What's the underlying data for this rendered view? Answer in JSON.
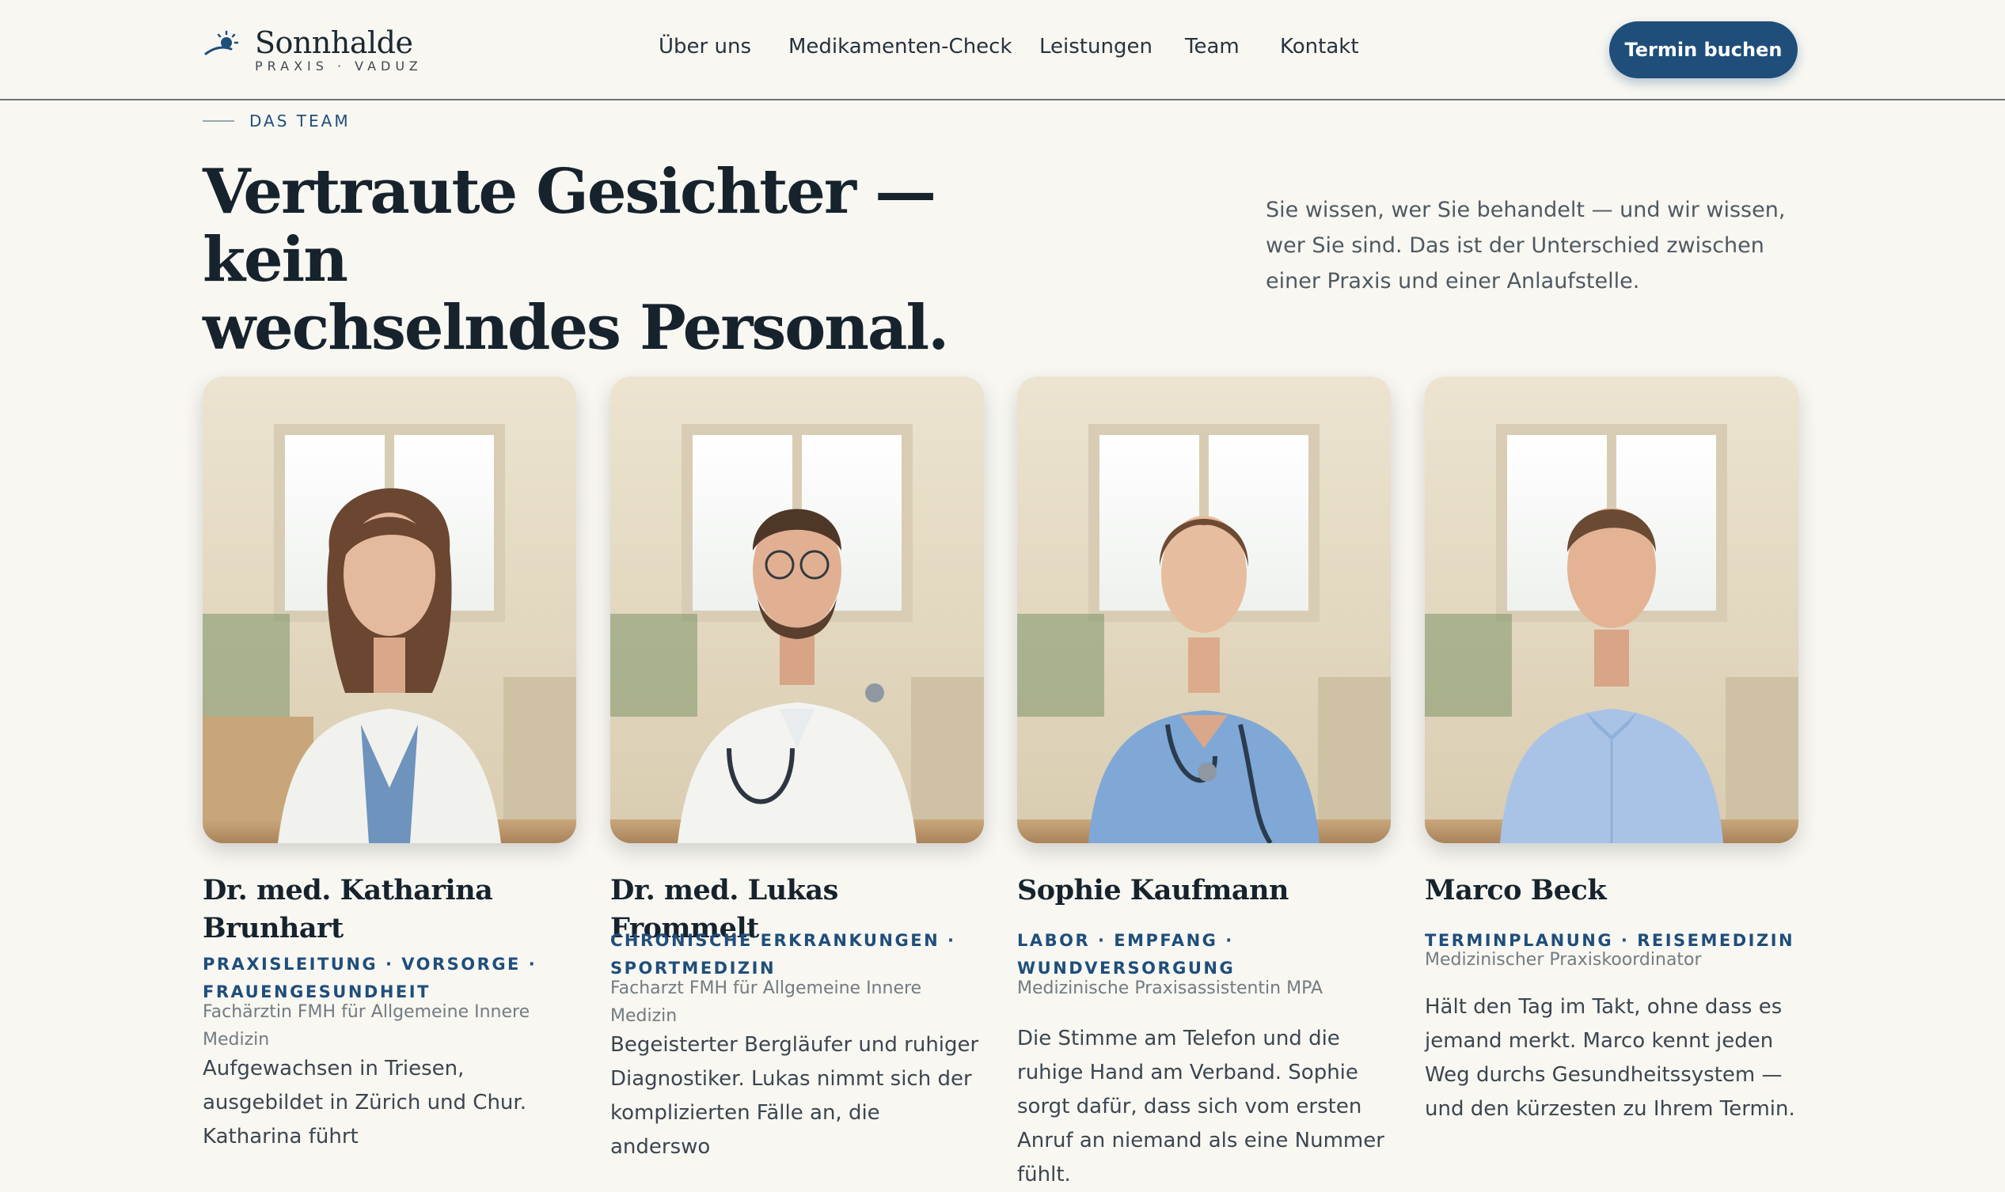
{
  "header": {
    "logo_name": "Sonnhalde",
    "logo_sub": "PRAXIS · VADUZ",
    "nav": [
      {
        "label": "Über uns"
      },
      {
        "label": "Medikamenten-Check"
      },
      {
        "label": "Leistungen"
      },
      {
        "label": "Team"
      },
      {
        "label": "Kontakt"
      }
    ],
    "cta_label": "Termin buchen"
  },
  "section": {
    "eyebrow": "DAS TEAM",
    "headline_line1": "Vertraute Gesichter — kein",
    "headline_line2": "wechselndes Personal.",
    "intro": "Sie wissen, wer Sie behandelt — und wir wissen, wer Sie sind. Das ist der Unterschied zwischen einer Praxis und einer Anlaufstelle."
  },
  "team": [
    {
      "name": "Dr. med. Katharina Brunhart",
      "tags": "PRAXISLEITUNG · VORSORGE · FRAUENGESUNDHEIT",
      "role": "Fachärztin FMH für Allgemeine Innere Medizin",
      "bio": "Aufgewachsen in Triesen, ausgebildet in Zürich und Chur. Katharina führt"
    },
    {
      "name": "Dr. med. Lukas Frommelt",
      "tags": "CHRONISCHE ERKRANKUNGEN · SPORTMEDIZIN",
      "role": "Facharzt FMH für Allgemeine Innere Medizin",
      "bio": "Begeisterter Bergläufer und ruhiger Diagnostiker. Lukas nimmt sich der komplizierten Fälle an, die anderswo"
    },
    {
      "name": "Sophie Kaufmann",
      "tags": "LABOR · EMPFANG · WUNDVERSORGUNG",
      "role": "Medizinische Praxisassistentin MPA",
      "bio": "Die Stimme am Telefon und die ruhige Hand am Verband. Sophie sorgt dafür, dass sich vom ersten Anruf an niemand als eine Nummer fühlt."
    },
    {
      "name": "Marco Beck",
      "tags": "TERMINPLANUNG · REISEMEDIZIN",
      "role": "Medizinischer Praxiskoordinator",
      "bio": "Hält den Tag im Takt, ohne dass es jemand merkt. Marco kennt jeden Weg durchs Gesundheitssystem — und den kürzesten zu Ihrem Termin."
    }
  ],
  "colors": {
    "background": "#f8f7f2",
    "accent": "#1f4e7b",
    "text_dark": "#16232d",
    "text_muted": "#737b82"
  }
}
